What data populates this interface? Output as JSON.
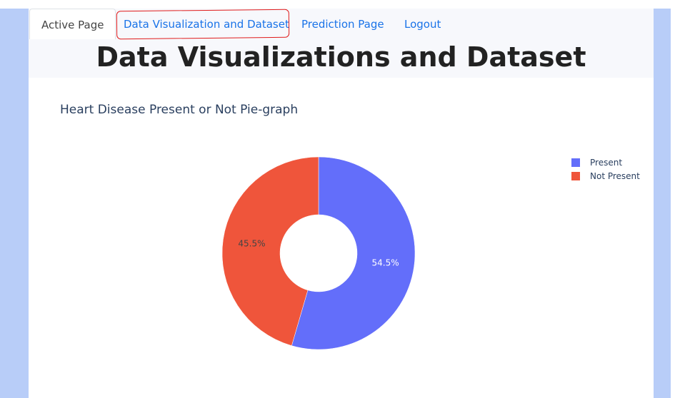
{
  "nav": {
    "tabs": [
      {
        "label": "Active Page"
      },
      {
        "label": "Data Visualization and Dataset"
      },
      {
        "label": "Prediction Page"
      },
      {
        "label": "Logout"
      }
    ]
  },
  "page": {
    "title": "Data Visualizations and Dataset"
  },
  "chart_data": {
    "type": "pie",
    "title": "Heart Disease Present or Not Pie-graph",
    "hole": 0.4,
    "labels": [
      "Present",
      "Not Present"
    ],
    "values": [
      54.5,
      45.5
    ],
    "colors": [
      "#636efa",
      "#ef553b"
    ],
    "text_labels": [
      "54.5%",
      "45.5%"
    ],
    "legend_position": "top-right"
  }
}
